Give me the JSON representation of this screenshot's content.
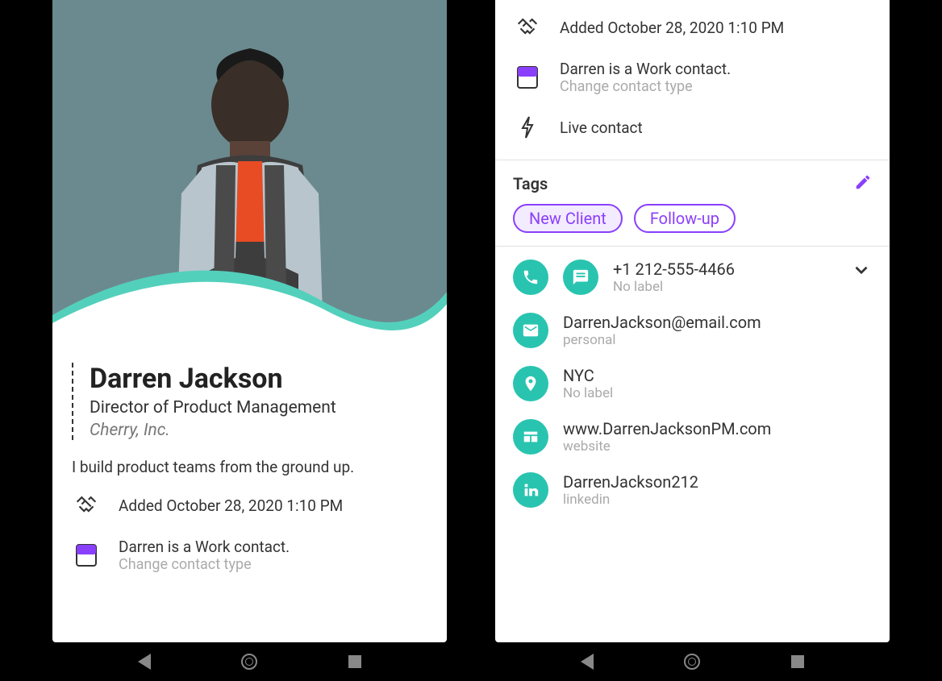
{
  "colors": {
    "accent": "#29c4b0",
    "purple": "#8a3ffc"
  },
  "profile": {
    "name": "Darren Jackson",
    "title": "Director of Product Management",
    "company": "Cherry, Inc.",
    "bio": "I build product teams from the ground up.",
    "added": "Added October 28, 2020 1:10 PM",
    "contact_type_line": "Darren is a Work contact.",
    "change_type": "Change contact type",
    "live": "Live contact"
  },
  "tags": {
    "header": "Tags",
    "items": [
      "New Client",
      "Follow-up"
    ]
  },
  "details": {
    "phone": {
      "value": "+1 212-555-4466",
      "label": "No label"
    },
    "email": {
      "value": "DarrenJackson@email.com",
      "label": "personal"
    },
    "location": {
      "value": "NYC",
      "label": "No label"
    },
    "website": {
      "value": "www.DarrenJacksonPM.com",
      "label": "website"
    },
    "linkedin": {
      "value": "DarrenJackson212",
      "label": "linkedin"
    }
  }
}
